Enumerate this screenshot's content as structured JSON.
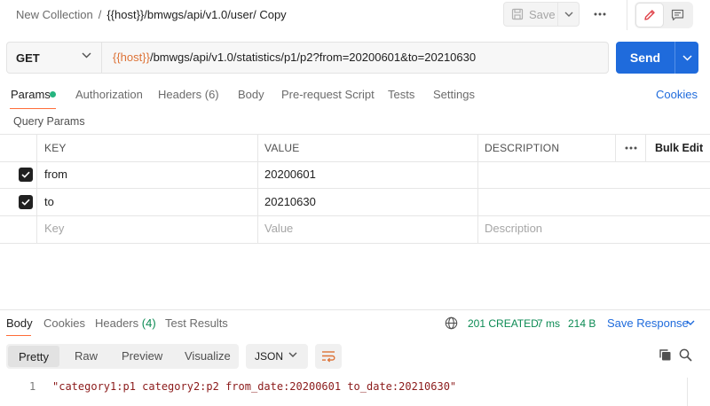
{
  "breadcrumb": {
    "collection": "New Collection",
    "separator": "/",
    "request": "{{host}}/bmwgs/api/v1.0/user/ Copy"
  },
  "toolbar": {
    "save_label": "Save",
    "save_icon": "floppy-disk-icon",
    "more_icon": "ellipsis-icon",
    "edit_icon": "pencil-icon",
    "doc_icon": "comment-icon"
  },
  "request": {
    "method": "GET",
    "url_variable": "{{host}}",
    "url_rest": "/bmwgs/api/v1.0/statistics/p1/p2?from=20200601&to=20210630",
    "send_label": "Send"
  },
  "request_tabs": {
    "params": "Params",
    "authorization": "Authorization",
    "headers": "Headers (6)",
    "body": "Body",
    "prerequest": "Pre-request Script",
    "tests": "Tests",
    "settings": "Settings",
    "cookies": "Cookies"
  },
  "query_params": {
    "title": "Query Params",
    "columns": {
      "key": "KEY",
      "value": "VALUE",
      "description": "DESCRIPTION"
    },
    "bulk_edit": "Bulk Edit",
    "rows": [
      {
        "checked": true,
        "key": "from",
        "value": "20200601",
        "description": ""
      },
      {
        "checked": true,
        "key": "to",
        "value": "20210630",
        "description": ""
      }
    ],
    "placeholders": {
      "key": "Key",
      "value": "Value",
      "description": "Description"
    }
  },
  "response": {
    "tabs": {
      "body": "Body",
      "cookies": "Cookies",
      "headers": "Headers",
      "headers_count": "(4)",
      "tests": "Test Results"
    },
    "status": "201 CREATED",
    "time": "7 ms",
    "size": "214 B",
    "save_response": "Save Response",
    "views": {
      "pretty": "Pretty",
      "raw": "Raw",
      "preview": "Preview",
      "visualize": "Visualize"
    },
    "language": "JSON",
    "line_number": "1",
    "body_line": "\"category1:p1 category2:p2 from_date:20200601 to_date:20210630\""
  },
  "colors": {
    "accent_blue": "#1f6bdc",
    "tab_underline": "#ff6c37",
    "variable_orange": "#dd7236",
    "status_green": "#0b8a53",
    "params_dot": "#26b47f",
    "string_red": "#8b1a1a"
  }
}
